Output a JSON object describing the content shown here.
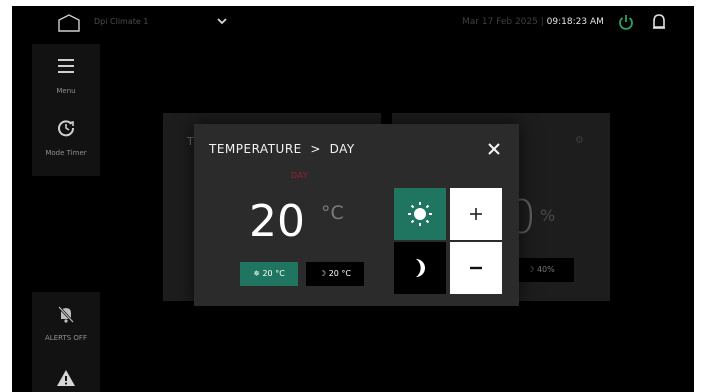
{
  "header": {
    "device_name": "Dpi Climate 1",
    "date": "Mar 17 Feb 2025",
    "separator": "|",
    "time": "09:18:23 AM",
    "power_color": "#2aa36a"
  },
  "nav": {
    "menu_label": "Menu",
    "mode_label": "Mode Timer",
    "alerts_label": "ALERTS OFF"
  },
  "background": {
    "left_tile_partial": "T",
    "right_value": "0",
    "right_unit": "%",
    "right_chip": "40%"
  },
  "modal": {
    "title": "TEMPERATURE",
    "title_arrow": ">",
    "subtitle": "DAY",
    "mode_label": "DAY",
    "value": "20",
    "unit": "°C",
    "day_chip": "20 °C",
    "night_chip": "20 °C",
    "plus": "+",
    "minus": "−",
    "accent_color": "#1f7560",
    "alert_color": "#9e1d35"
  }
}
